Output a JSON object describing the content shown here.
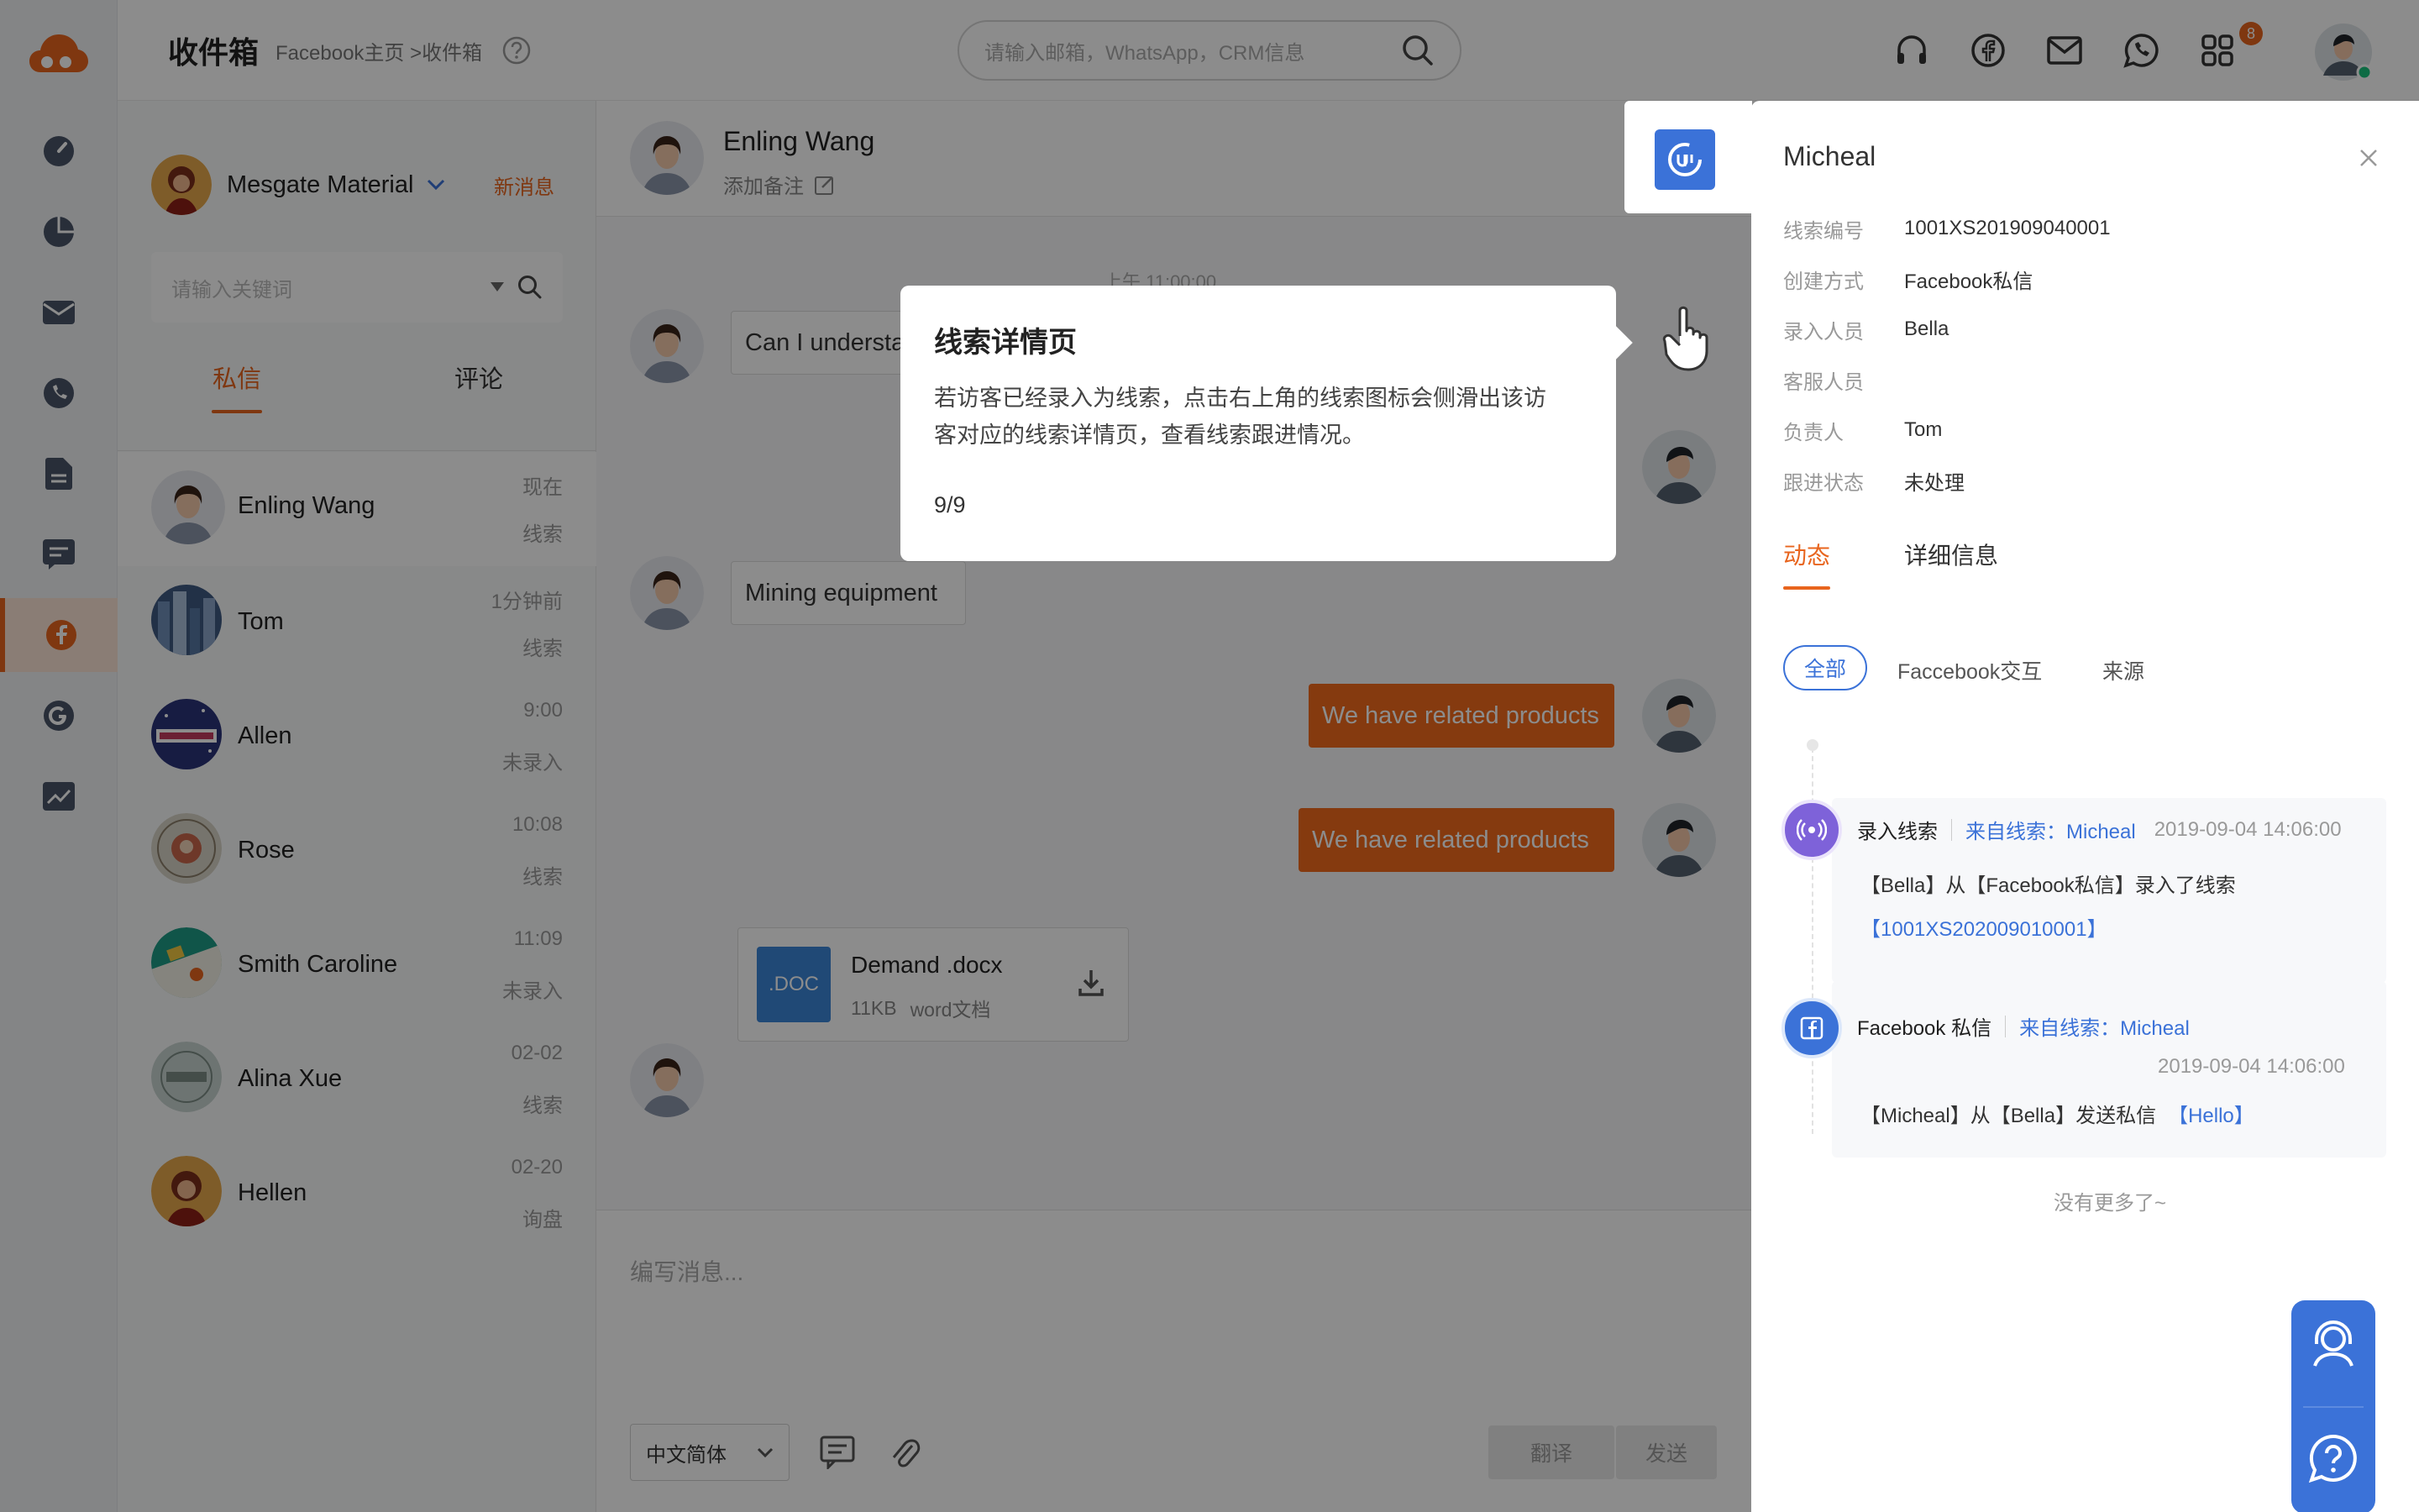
{
  "header": {
    "title": "收件箱",
    "breadcrumb": "Facebook主页 >收件箱",
    "search_placeholder": "请输入邮箱，WhatsApp，CRM信息",
    "apps_badge": "8"
  },
  "account": {
    "name": "Mesgate Material",
    "new_msg": "新消息",
    "search_placeholder": "请输入关键词"
  },
  "conv_tabs": [
    {
      "label": "私信"
    },
    {
      "label": "评论"
    }
  ],
  "conversations": [
    {
      "name": "Enling Wang",
      "time": "现在",
      "status": "线索"
    },
    {
      "name": "Tom",
      "time": "1分钟前",
      "status": "线索"
    },
    {
      "name": "Allen",
      "time": "9:00",
      "status": "未录入"
    },
    {
      "name": "Rose",
      "time": "10:08",
      "status": "线索"
    },
    {
      "name": "Smith Caroline",
      "time": "11:09",
      "status": "未录入"
    },
    {
      "name": "Alina Xue",
      "time": "02-02",
      "status": "线索"
    },
    {
      "name": "Hellen",
      "time": "02-20",
      "status": "询盘"
    }
  ],
  "chat": {
    "contact": "Enling Wang",
    "add_note": "添加备注",
    "date_sep": "上午 11:00:00",
    "messages": [
      {
        "text": "Can I understa"
      },
      {
        "text": "Mining equipment"
      },
      {
        "text": "We have related products"
      },
      {
        "text": "We have related products"
      }
    ],
    "file": {
      "ext": ".DOC",
      "name": "Demand .docx",
      "size": "11KB",
      "type": "word文档"
    },
    "compose_placeholder": "编写消息...",
    "language": "中文简体",
    "translate": "翻译",
    "send": "发送"
  },
  "tooltip": {
    "title": "线索详情页",
    "line1": "若访客已经录入为线索，点击右上角的线索图标会侧滑出该访",
    "line2": "客对应的线索详情页，查看线索跟进情况。",
    "step": "9/9"
  },
  "drawer": {
    "name": "Micheal",
    "fields": [
      {
        "label": "线索编号",
        "value": "1001XS201909040001"
      },
      {
        "label": "创建方式",
        "value": "Facebook私信"
      },
      {
        "label": "录入人员",
        "value": "Bella"
      },
      {
        "label": "客服人员",
        "value": ""
      },
      {
        "label": "负责人",
        "value": "Tom"
      },
      {
        "label": "跟进状态",
        "value": "未处理"
      }
    ],
    "tabs": [
      {
        "label": "动态"
      },
      {
        "label": "详细信息"
      }
    ],
    "filters": [
      {
        "label": "全部"
      },
      {
        "label": "Faccebook交互"
      },
      {
        "label": "来源"
      }
    ],
    "timeline": [
      {
        "type": "录入线索",
        "from": "来自线索：Micheal",
        "time": "2019-09-04 14:06:00",
        "body": "【Bella】从【Facebook私信】录入了线索",
        "link": "【1001XS202009010001】"
      },
      {
        "type": "Facebook 私信",
        "from": "来自线索：Micheal",
        "time": "2019-09-04 14:06:00",
        "body": "【Micheal】从【Bella】发送私信",
        "link": "【Hello】"
      }
    ],
    "no_more": "没有更多了~"
  },
  "colors": {
    "accent": "#e8651e",
    "blue": "#3b72d8",
    "purple": "#7e62d9"
  },
  "icons": [
    "cloud-logo-icon",
    "dashboard-icon",
    "pie-chart-icon",
    "mail-icon",
    "phone-icon",
    "document-icon",
    "message-icon",
    "facebook-icon",
    "google-icon",
    "trend-icon",
    "help-icon",
    "search-icon",
    "headset-icon",
    "mail-icon",
    "whatsapp-icon",
    "apps-icon",
    "chevron-down-icon",
    "edit-icon",
    "download-icon",
    "chat-icon",
    "attachment-icon",
    "close-icon",
    "hand-pointer-icon",
    "lead-icon",
    "broadcast-icon",
    "facebook-square-icon",
    "support-agent-icon",
    "question-icon"
  ]
}
